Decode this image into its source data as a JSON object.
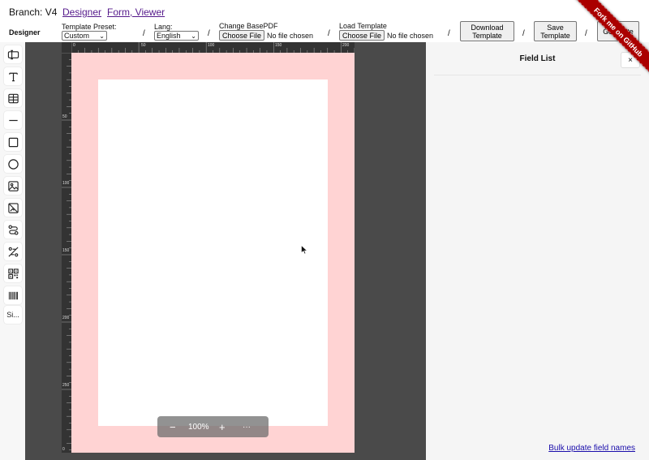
{
  "nav": {
    "branch": "Branch: V4",
    "links": [
      "Designer",
      "Form, Viewer"
    ]
  },
  "controls": {
    "designer_label": "Designer",
    "template_preset": {
      "label": "Template Preset:",
      "value": "Custom"
    },
    "lang": {
      "label": "Lang:",
      "value": "English"
    },
    "change_basepdf": {
      "label": "Change BasePDF",
      "button": "Choose File",
      "status": "No file chosen"
    },
    "load_template": {
      "label": "Load Template",
      "button": "Choose File",
      "status": "No file chosen"
    },
    "separator": "/",
    "download_template": "Download Template",
    "save_template": "Save Template",
    "generate": "Generate"
  },
  "ribbon": {
    "text": "Fork me on GitHub",
    "color": "#aa0000"
  },
  "toolbar": {
    "tools": [
      {
        "name": "text-field-icon"
      },
      {
        "name": "text-icon"
      },
      {
        "name": "table-icon"
      },
      {
        "name": "line-icon"
      },
      {
        "name": "rectangle-icon"
      },
      {
        "name": "ellipse-icon"
      },
      {
        "name": "image-icon"
      },
      {
        "name": "svg-icon"
      },
      {
        "name": "route-icon"
      },
      {
        "name": "signature-icon"
      },
      {
        "name": "qrcode-icon"
      },
      {
        "name": "barcode-icon"
      }
    ],
    "more_label": "Si..."
  },
  "ruler": {
    "top_ticks": [
      "0",
      "50",
      "100",
      "150",
      "200"
    ],
    "left_ticks": [
      "50",
      "100",
      "150",
      "200",
      "250",
      "0"
    ]
  },
  "zoom": {
    "minus": "−",
    "value": "100%",
    "plus": "+",
    "more": "···"
  },
  "right_panel": {
    "title": "Field List",
    "close": "×",
    "bulk_update": "Bulk update field names"
  },
  "colors": {
    "page_padding": "#ff8c8c",
    "canvas": "#4a4a4a",
    "ruler": "#333333"
  }
}
